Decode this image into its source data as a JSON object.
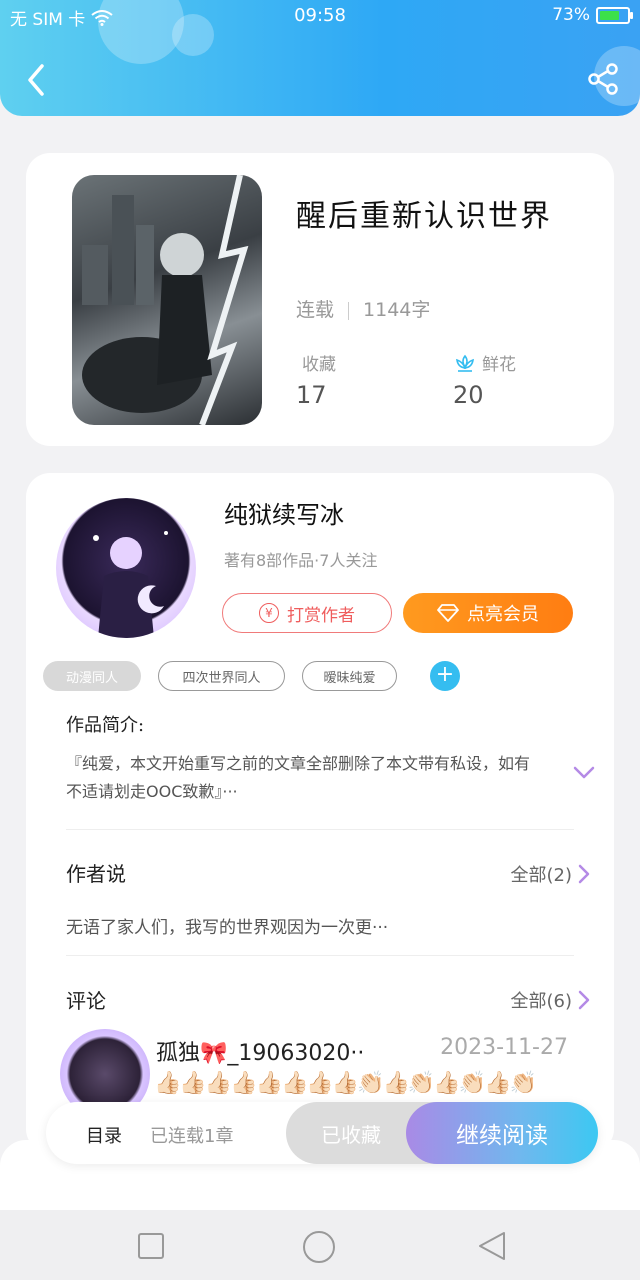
{
  "status_bar": {
    "carrier": "无 SIM 卡",
    "time": "09:58",
    "battery": "73%",
    "battery_level": 0.73
  },
  "header": {
    "back_icon": "chevron-left-icon",
    "share_icon": "share-icon"
  },
  "book": {
    "title": "醒后重新认识世界",
    "status": "连载",
    "word_count": "1144字",
    "favorites_label": "收藏",
    "favorites_value": "17",
    "flowers_label": "鲜花",
    "flowers_value": "20"
  },
  "author": {
    "name": "纯狱续写冰",
    "meta": "著有8部作品·7人关注",
    "tip_label": "打赏作者",
    "vip_label": "点亮会员"
  },
  "tags": [
    "动漫同人",
    "四次世界同人",
    "暧昧纯爱"
  ],
  "intro": {
    "title": "作品简介:",
    "text": "『纯爱，本文开始重写之前的文章全部删除了本文带有私设，如有不适请划走OOC致歉』···"
  },
  "author_says": {
    "title": "作者说",
    "see_all": "全部(2)",
    "text": "无语了家人们，我写的世界观因为一次更···"
  },
  "comments": {
    "title": "评论",
    "see_all": "全部(6)",
    "first": {
      "user": "孤独🎀_19063020··",
      "date": "2023-11-27",
      "body": "👍🏻👍🏻👍🏻👍🏻👍🏻👍🏻👍🏻👍🏻👏🏻👍🏻👏🏻👍🏻👏🏻👍🏻👏🏻"
    }
  },
  "action_bar": {
    "toc_label": "目录",
    "toc_count": "已连载1章",
    "collected_label": "已收藏",
    "read_label": "继续阅读"
  },
  "colors": {
    "header_start": "#5fd0f0",
    "header_end": "#3aa2f3",
    "vip_orange": "#ff8a18",
    "tip_red": "#ef5d5d",
    "accent_purple": "#b48ae6"
  }
}
